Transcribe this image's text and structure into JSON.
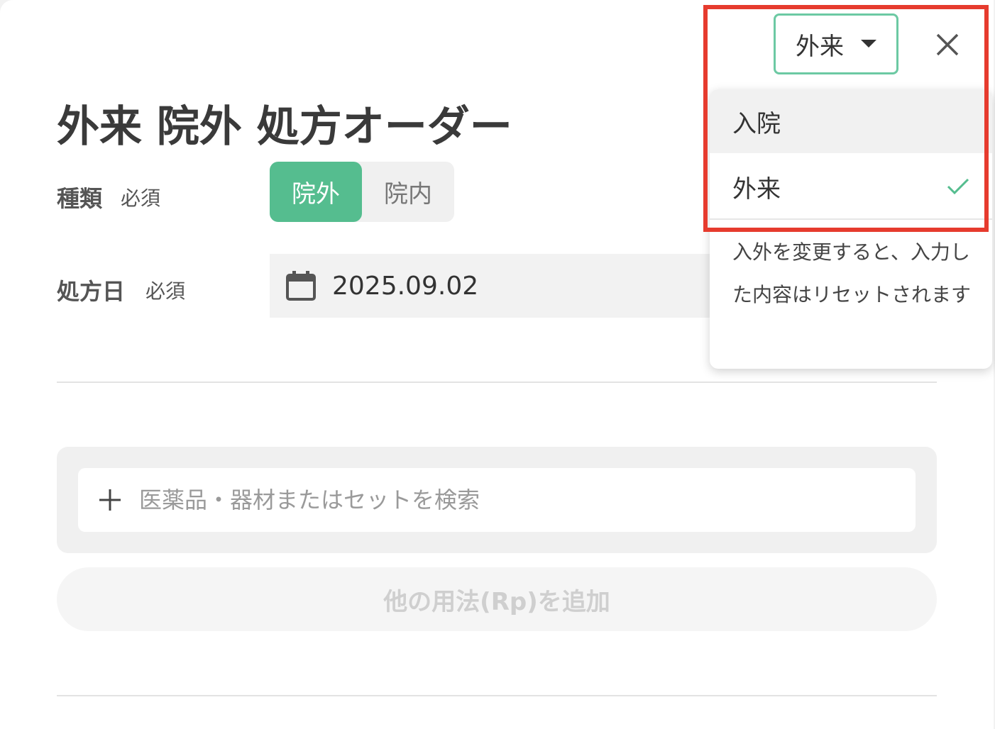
{
  "page": {
    "title": "外来 院外 処方オーダー"
  },
  "form": {
    "type_label": "種類",
    "type_required": "必須",
    "type_options": [
      "院外",
      "院内"
    ],
    "type_selected": "院外",
    "date_label": "処方日",
    "date_required": "必須",
    "date_value": "2025.09.02",
    "search_placeholder": "医薬品・器材またはセットを検索",
    "add_rp_label": "他の用法(Rp)を追加"
  },
  "visit_select": {
    "current_value": "外来",
    "options": [
      {
        "label": "入院",
        "selected": false
      },
      {
        "label": "外来",
        "selected": true
      }
    ],
    "note": "入外を変更すると、入力した内容はリセットされます"
  },
  "icons": {
    "caret": "caret-down-icon",
    "close": "close-icon",
    "check": "check-icon",
    "calendar": "calendar-icon",
    "plus": "plus-icon"
  },
  "colors": {
    "accent_green": "#55bd8f",
    "select_border": "#6cc9a3",
    "highlight_red": "#e63b2e"
  }
}
